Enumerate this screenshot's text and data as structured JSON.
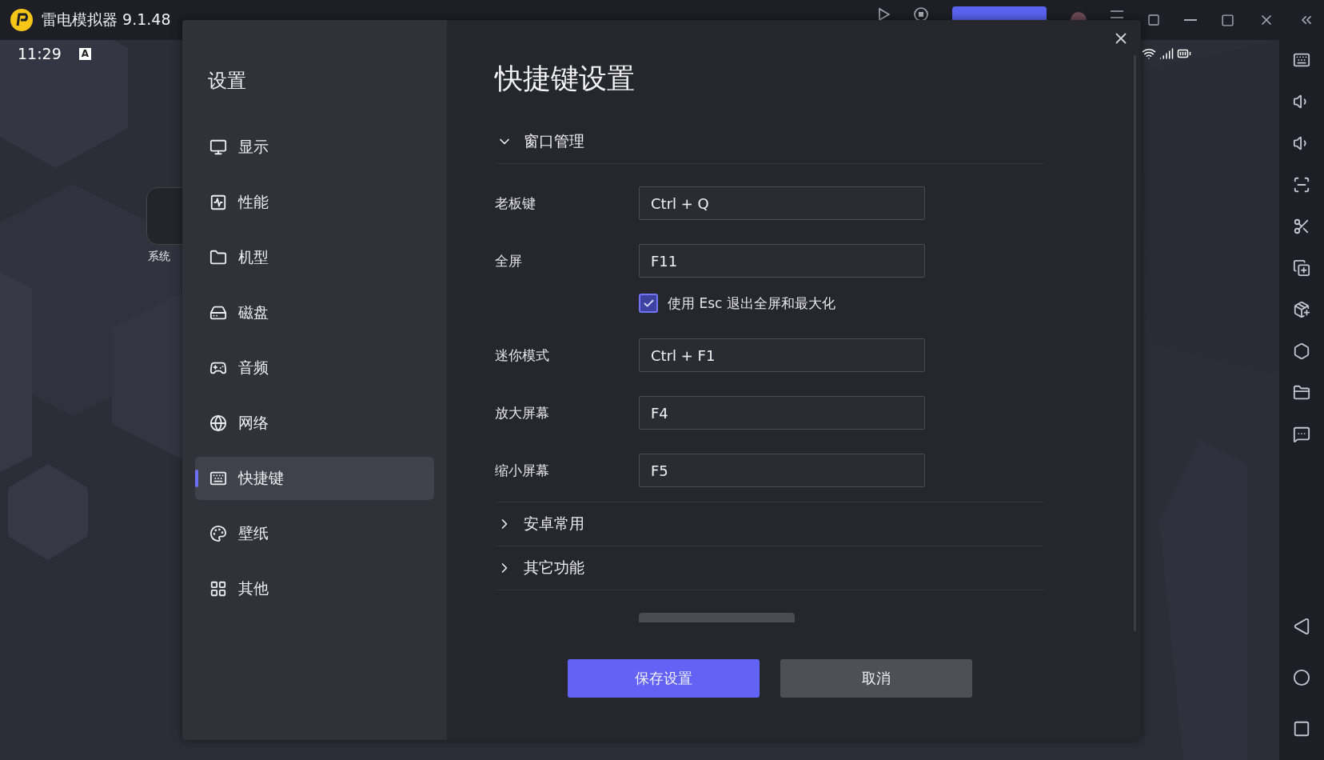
{
  "title_bar": {
    "app_name": "雷电模拟器 9.1.48"
  },
  "status_bar": {
    "time": "11:29",
    "indicator": "A"
  },
  "desktop": {
    "folder_label": "系统"
  },
  "settings": {
    "title": "设置",
    "nav": [
      {
        "label": "显示",
        "selected": false
      },
      {
        "label": "性能",
        "selected": false
      },
      {
        "label": "机型",
        "selected": false
      },
      {
        "label": "磁盘",
        "selected": false
      },
      {
        "label": "音频",
        "selected": false
      },
      {
        "label": "网络",
        "selected": false
      },
      {
        "label": "快捷键",
        "selected": true
      },
      {
        "label": "壁纸",
        "selected": false
      },
      {
        "label": "其他",
        "selected": false
      }
    ]
  },
  "shortcut_panel": {
    "title": "快捷键设置",
    "sections": [
      {
        "title": "窗口管理",
        "expanded": true,
        "rows": [
          {
            "kind": "key",
            "label": "老板键",
            "value": "Ctrl + Q"
          },
          {
            "kind": "key",
            "label": "全屏",
            "value": "F11"
          },
          {
            "kind": "checkbox",
            "label": "使用 Esc 退出全屏和最大化",
            "checked": true
          },
          {
            "kind": "key",
            "label": "迷你模式",
            "value": "Ctrl + F1"
          },
          {
            "kind": "key",
            "label": "放大屏幕",
            "value": "F4"
          },
          {
            "kind": "key",
            "label": "缩小屏幕",
            "value": "F5"
          }
        ]
      },
      {
        "title": "安卓常用",
        "expanded": false
      },
      {
        "title": "其它功能",
        "expanded": false
      }
    ],
    "buttons": [
      {
        "label": "保存设置",
        "kind": "primary"
      },
      {
        "label": "取消",
        "kind": "secondary"
      }
    ]
  }
}
